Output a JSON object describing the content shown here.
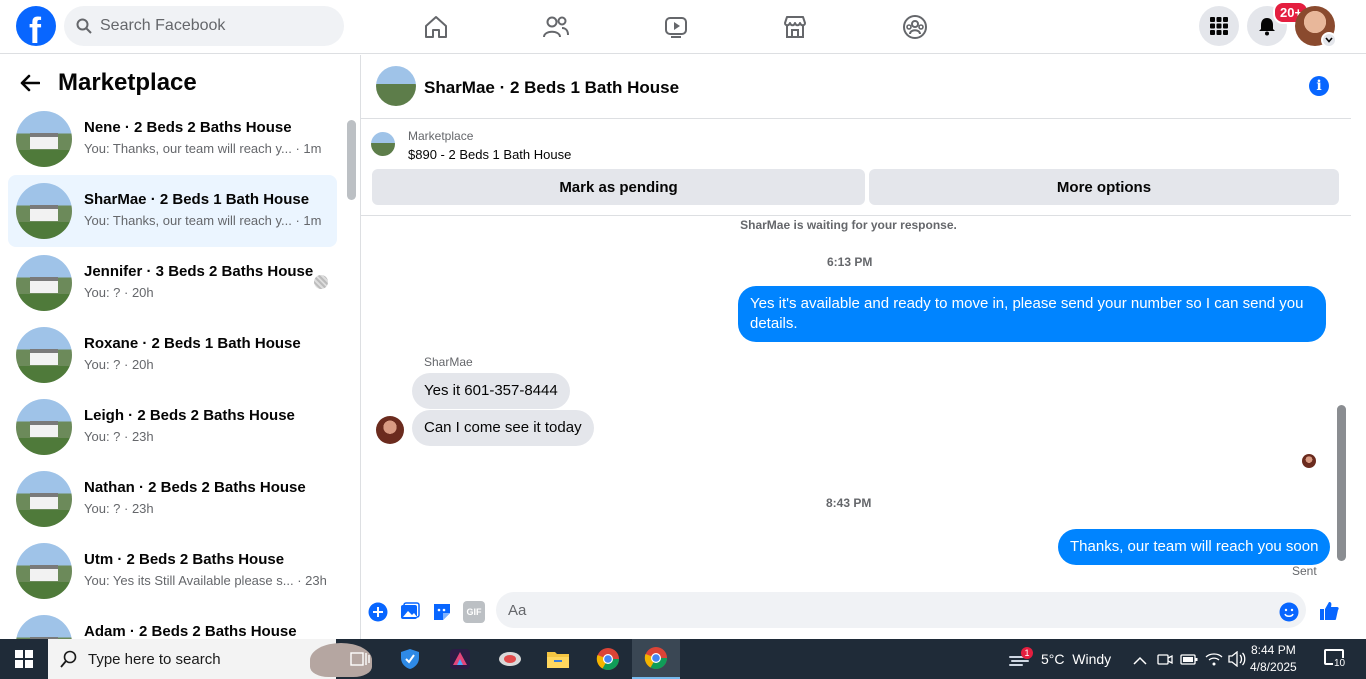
{
  "topbar": {
    "logo_letter": "f",
    "search_placeholder": "Search Facebook",
    "notification_count": "20+",
    "nav_icons": [
      "home-icon",
      "friends-icon",
      "video-icon",
      "marketplace-icon",
      "groups-icon"
    ]
  },
  "sidebar": {
    "title": "Marketplace",
    "conversations": [
      {
        "name": "Nene · 2 Beds 2 Baths House",
        "preview": "You: Thanks, our team will reach y... · 1m",
        "active": false
      },
      {
        "name": "SharMae · 2 Beds 1 Bath House",
        "preview": "You: Thanks, our team will reach y... · 1m",
        "active": true
      },
      {
        "name": "Jennifer · 3 Beds 2 Baths House",
        "preview": "You: ? · 20h",
        "active": false
      },
      {
        "name": "Roxane · 2 Beds 1 Bath House",
        "preview": "You: ? · 20h",
        "active": false
      },
      {
        "name": "Leigh · 2 Beds 2 Baths House",
        "preview": "You: ? · 23h",
        "active": false
      },
      {
        "name": "Nathan · 2 Beds 2 Baths House",
        "preview": "You: ? · 23h",
        "active": false
      },
      {
        "name": "Utm · 2 Beds 2 Baths House",
        "preview": "You: Yes its Still Available please s... · 23h",
        "active": false
      },
      {
        "name": "Adam · 2 Beds 2 Baths House",
        "preview": "",
        "active": false
      }
    ]
  },
  "chat": {
    "title": "SharMae · 2 Beds 1 Bath House",
    "listing_source": "Marketplace",
    "listing_summary": "$890 - 2 Beds 1 Bath House",
    "mark_pending_label": "Mark as pending",
    "more_options_label": "More options",
    "waiting_notice": "SharMae is waiting for your response.",
    "time1": "6:13 PM",
    "msg_out_1": "Yes it's available and ready to move in, please send your number so I can send you details.",
    "sender_name": "SharMae",
    "msg_in_1": "Yes it 601-357-8444",
    "msg_in_2": "Can I come see it today",
    "time2": "8:43 PM",
    "msg_out_2": "Thanks, our team will reach you soon",
    "sent_label": "Sent",
    "composer_placeholder": "Aa",
    "gif_label": "GIF"
  },
  "taskbar": {
    "search_placeholder": "Type here to search",
    "weather": "5°C  Windy",
    "weather_alert": "1",
    "time": "8:44 PM",
    "date": "4/8/2025",
    "notification_count": "10"
  },
  "colors": {
    "brand": "#0866ff",
    "bubble_out": "#0084ff",
    "bubble_in": "#e4e6eb",
    "active_row": "#ebf5ff",
    "badge": "#e41e3f"
  }
}
